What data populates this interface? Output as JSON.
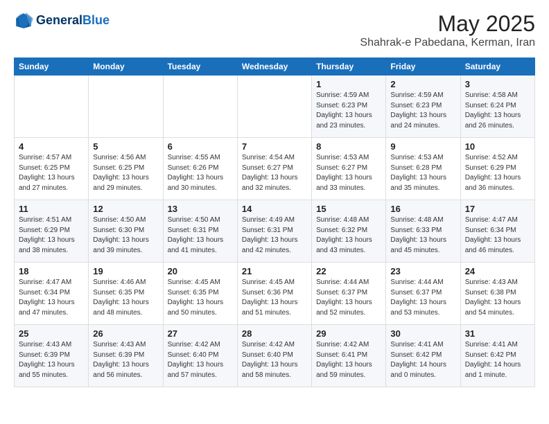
{
  "header": {
    "logo_line1": "General",
    "logo_line2": "Blue",
    "title": "May 2025",
    "subtitle": "Shahrak-e Pabedana, Kerman, Iran"
  },
  "weekdays": [
    "Sunday",
    "Monday",
    "Tuesday",
    "Wednesday",
    "Thursday",
    "Friday",
    "Saturday"
  ],
  "weeks": [
    [
      {
        "day": "",
        "info": ""
      },
      {
        "day": "",
        "info": ""
      },
      {
        "day": "",
        "info": ""
      },
      {
        "day": "",
        "info": ""
      },
      {
        "day": "1",
        "info": "Sunrise: 4:59 AM\nSunset: 6:23 PM\nDaylight: 13 hours\nand 23 minutes."
      },
      {
        "day": "2",
        "info": "Sunrise: 4:59 AM\nSunset: 6:23 PM\nDaylight: 13 hours\nand 24 minutes."
      },
      {
        "day": "3",
        "info": "Sunrise: 4:58 AM\nSunset: 6:24 PM\nDaylight: 13 hours\nand 26 minutes."
      }
    ],
    [
      {
        "day": "4",
        "info": "Sunrise: 4:57 AM\nSunset: 6:25 PM\nDaylight: 13 hours\nand 27 minutes."
      },
      {
        "day": "5",
        "info": "Sunrise: 4:56 AM\nSunset: 6:25 PM\nDaylight: 13 hours\nand 29 minutes."
      },
      {
        "day": "6",
        "info": "Sunrise: 4:55 AM\nSunset: 6:26 PM\nDaylight: 13 hours\nand 30 minutes."
      },
      {
        "day": "7",
        "info": "Sunrise: 4:54 AM\nSunset: 6:27 PM\nDaylight: 13 hours\nand 32 minutes."
      },
      {
        "day": "8",
        "info": "Sunrise: 4:53 AM\nSunset: 6:27 PM\nDaylight: 13 hours\nand 33 minutes."
      },
      {
        "day": "9",
        "info": "Sunrise: 4:53 AM\nSunset: 6:28 PM\nDaylight: 13 hours\nand 35 minutes."
      },
      {
        "day": "10",
        "info": "Sunrise: 4:52 AM\nSunset: 6:29 PM\nDaylight: 13 hours\nand 36 minutes."
      }
    ],
    [
      {
        "day": "11",
        "info": "Sunrise: 4:51 AM\nSunset: 6:29 PM\nDaylight: 13 hours\nand 38 minutes."
      },
      {
        "day": "12",
        "info": "Sunrise: 4:50 AM\nSunset: 6:30 PM\nDaylight: 13 hours\nand 39 minutes."
      },
      {
        "day": "13",
        "info": "Sunrise: 4:50 AM\nSunset: 6:31 PM\nDaylight: 13 hours\nand 41 minutes."
      },
      {
        "day": "14",
        "info": "Sunrise: 4:49 AM\nSunset: 6:31 PM\nDaylight: 13 hours\nand 42 minutes."
      },
      {
        "day": "15",
        "info": "Sunrise: 4:48 AM\nSunset: 6:32 PM\nDaylight: 13 hours\nand 43 minutes."
      },
      {
        "day": "16",
        "info": "Sunrise: 4:48 AM\nSunset: 6:33 PM\nDaylight: 13 hours\nand 45 minutes."
      },
      {
        "day": "17",
        "info": "Sunrise: 4:47 AM\nSunset: 6:34 PM\nDaylight: 13 hours\nand 46 minutes."
      }
    ],
    [
      {
        "day": "18",
        "info": "Sunrise: 4:47 AM\nSunset: 6:34 PM\nDaylight: 13 hours\nand 47 minutes."
      },
      {
        "day": "19",
        "info": "Sunrise: 4:46 AM\nSunset: 6:35 PM\nDaylight: 13 hours\nand 48 minutes."
      },
      {
        "day": "20",
        "info": "Sunrise: 4:45 AM\nSunset: 6:35 PM\nDaylight: 13 hours\nand 50 minutes."
      },
      {
        "day": "21",
        "info": "Sunrise: 4:45 AM\nSunset: 6:36 PM\nDaylight: 13 hours\nand 51 minutes."
      },
      {
        "day": "22",
        "info": "Sunrise: 4:44 AM\nSunset: 6:37 PM\nDaylight: 13 hours\nand 52 minutes."
      },
      {
        "day": "23",
        "info": "Sunrise: 4:44 AM\nSunset: 6:37 PM\nDaylight: 13 hours\nand 53 minutes."
      },
      {
        "day": "24",
        "info": "Sunrise: 4:43 AM\nSunset: 6:38 PM\nDaylight: 13 hours\nand 54 minutes."
      }
    ],
    [
      {
        "day": "25",
        "info": "Sunrise: 4:43 AM\nSunset: 6:39 PM\nDaylight: 13 hours\nand 55 minutes."
      },
      {
        "day": "26",
        "info": "Sunrise: 4:43 AM\nSunset: 6:39 PM\nDaylight: 13 hours\nand 56 minutes."
      },
      {
        "day": "27",
        "info": "Sunrise: 4:42 AM\nSunset: 6:40 PM\nDaylight: 13 hours\nand 57 minutes."
      },
      {
        "day": "28",
        "info": "Sunrise: 4:42 AM\nSunset: 6:40 PM\nDaylight: 13 hours\nand 58 minutes."
      },
      {
        "day": "29",
        "info": "Sunrise: 4:42 AM\nSunset: 6:41 PM\nDaylight: 13 hours\nand 59 minutes."
      },
      {
        "day": "30",
        "info": "Sunrise: 4:41 AM\nSunset: 6:42 PM\nDaylight: 14 hours\nand 0 minutes."
      },
      {
        "day": "31",
        "info": "Sunrise: 4:41 AM\nSunset: 6:42 PM\nDaylight: 14 hours\nand 1 minute."
      }
    ]
  ]
}
